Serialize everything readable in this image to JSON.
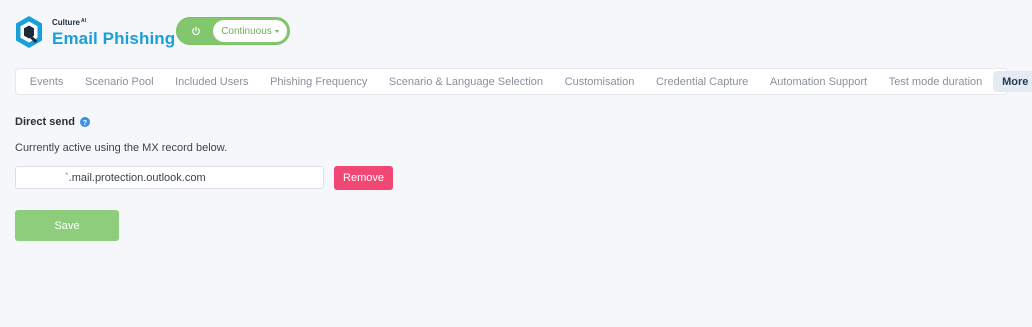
{
  "app": {
    "brand_top": "Culture",
    "brand_superscript": "AI",
    "brand_name": "Email Phishing",
    "logo_icon": "culture-ai-q-logo",
    "brand_color": "#1aa0d8"
  },
  "mode_toggle": {
    "power_icon": "power-icon",
    "selected_mode": "Continuous",
    "accent_color": "#82c76e"
  },
  "tabs": [
    {
      "label": "Events"
    },
    {
      "label": "Scenario Pool"
    },
    {
      "label": "Included Users"
    },
    {
      "label": "Phishing Frequency"
    },
    {
      "label": "Scenario & Language Selection"
    },
    {
      "label": "Customisation"
    },
    {
      "label": "Credential Capture"
    },
    {
      "label": "Automation Support"
    },
    {
      "label": "Test mode duration"
    },
    {
      "label": "More",
      "active": true
    }
  ],
  "direct_send": {
    "title": "Direct send",
    "help_icon": "question-circle-icon",
    "help_glyph": "?",
    "status": "Currently active using the MX record below.",
    "mx_record_value": "`.mail.protection.outlook.com",
    "remove_label": "Remove",
    "remove_color": "#f04774"
  },
  "save_label": "Save",
  "save_color": "#8dcd7c"
}
